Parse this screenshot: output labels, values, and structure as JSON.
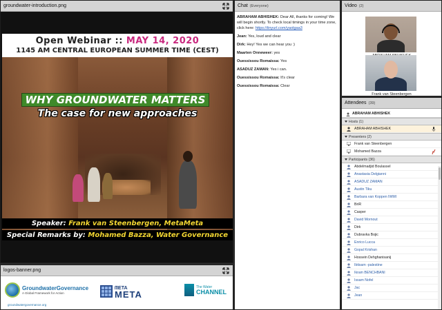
{
  "share_pod": {
    "title": "groundwater-introduction.png",
    "slide": {
      "head_prefix": "Open Webinar :: ",
      "head_date": "MAY 14, 2020",
      "head_time": "1145 AM CENTRAL EUROPEAN SUMMER TIME (CEST)",
      "banner": "WHY GROUNDWATER MATTERS",
      "subtitle": "The case for new approaches",
      "speaker_label": "Speaker: ",
      "speaker_name": "Frank van Steenbergen, MetaMeta",
      "remarks_label": "Special Remarks by: ",
      "remarks_name": "Mohamed Bazza, Water Governance Expert"
    }
  },
  "logos_pod": {
    "title": "logos-banner.png",
    "gg_title": "GroundwaterGovernance",
    "gg_tagline": "A Global Framework for Action",
    "gg_url": "groundwatergovernance.org",
    "meta_small": "ᗰETA",
    "meta_big": "META",
    "water_small": "The Water",
    "water_big": "CHANNEL"
  },
  "chat": {
    "title": "Chat",
    "scope": "(Everyone)",
    "messages": [
      {
        "who": "ABRAHAM ABHISHEK:",
        "text": "Dear All, thanks for coming! We will begin shortly. To check local timings in your time zone, click here: ",
        "link": "https://tinyurl.com/yaolgaa3"
      },
      {
        "who": "Jean:",
        "text": "Yes, loud and clear"
      },
      {
        "who": "Dirk:",
        "text": "Hey! Yes we can hear you :)"
      },
      {
        "who": "Maarten Onneweer:",
        "text": "yes"
      },
      {
        "who": "Ouessissou Romaissa:",
        "text": "Yes"
      },
      {
        "who": "ASADUZ ZAMAN:",
        "text": "Yes i can."
      },
      {
        "who": "Ouessissou Romaissa:",
        "text": "It's clear"
      },
      {
        "who": "Ouessissou Romaissa:",
        "text": "Clear"
      }
    ]
  },
  "video": {
    "title": "Video",
    "count": "(2)",
    "cams": [
      {
        "label": "ABRAHAM ABHISHEK"
      },
      {
        "label": "Frank van Steenbergen"
      }
    ]
  },
  "attendees": {
    "title": "Attendees",
    "count": "(39)",
    "me": "ABRAHAM ABHISHEK",
    "hosts_label": "Hosts (1)",
    "hosts": [
      "ABRAHAM ABHISHEK"
    ],
    "presenters_label": "Presenters (2)",
    "presenters": [
      "Frank van Steenbergen",
      "Mohamed Bazza"
    ],
    "participants_label": "Participants (36)",
    "participants": [
      {
        "name": "Abdelmadjid Boulassel",
        "blue": false
      },
      {
        "name": "Anastasia Delgianni",
        "blue": true
      },
      {
        "name": "ASADUZ ZAMAN",
        "blue": true
      },
      {
        "name": "Austin Tiku",
        "blue": true
      },
      {
        "name": "Barbara van Koppen IWMI",
        "blue": true
      },
      {
        "name": "BriR",
        "blue": false
      },
      {
        "name": "Casper",
        "blue": false
      },
      {
        "name": "David Mornout",
        "blue": true
      },
      {
        "name": "Dirk",
        "blue": false
      },
      {
        "name": "Dubravka Bojic",
        "blue": false
      },
      {
        "name": "Enrico Lucca",
        "blue": true
      },
      {
        "name": "Gopal Krishan",
        "blue": true
      },
      {
        "name": "Hossein Dehghanisanij",
        "blue": false
      },
      {
        "name": "Ibtisam -palestine",
        "blue": true
      },
      {
        "name": "Ikram BENCHBANI",
        "blue": true
      },
      {
        "name": "Issam Nofel",
        "blue": true
      },
      {
        "name": "Jac",
        "blue": true
      },
      {
        "name": "Jean",
        "blue": true
      }
    ]
  },
  "colors": {
    "accent_date": "#c8287e",
    "banner_green": "#3f8a2a",
    "speaker_yellow": "#f2d632",
    "link_blue": "#2158b8"
  }
}
